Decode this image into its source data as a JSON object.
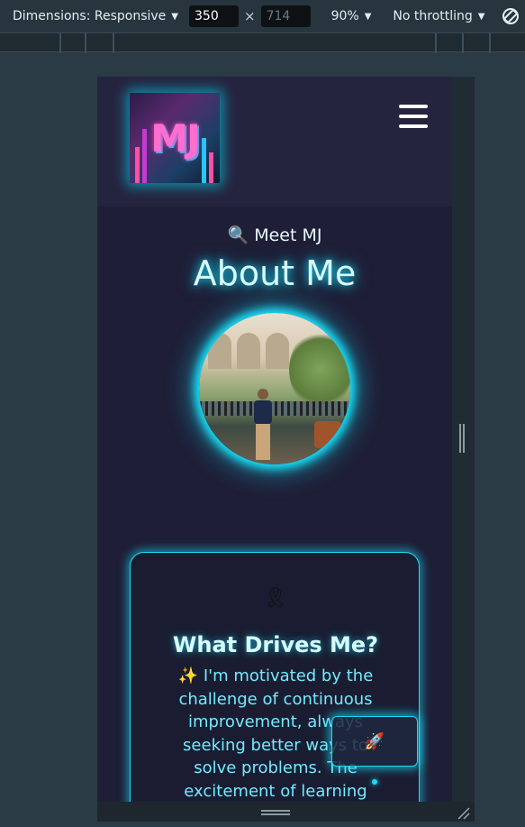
{
  "toolbar": {
    "dimensions_label": "Dimensions: Responsive",
    "width_value": "350",
    "height_placeholder": "714",
    "times": "×",
    "zoom_label": "90%",
    "throttling_label": "No throttling"
  },
  "header": {
    "logo_text": "MJ"
  },
  "about": {
    "meet_label": "🔍 Meet MJ",
    "title": "About Me"
  },
  "card": {
    "icon": "🎗",
    "title": "What Drives Me?",
    "text": "✨ I'm motivated by the challenge of continuous improvement, always seeking better ways to solve problems. The excitement of learning"
  },
  "float_button": {
    "label": "🚀"
  },
  "icons": [
    "chevron-down-icon",
    "rotate-icon",
    "hamburger-menu-icon",
    "magnifier-icon",
    "ribbon-icon",
    "rocket-icon",
    "sparkles-icon",
    "resize-icon"
  ],
  "colors": {
    "accent": "#18e4ff",
    "page_bg": "#1e1e36",
    "header_bg": "#25243f",
    "title_text": "#d9fbff",
    "body_text": "#74e9ff"
  }
}
